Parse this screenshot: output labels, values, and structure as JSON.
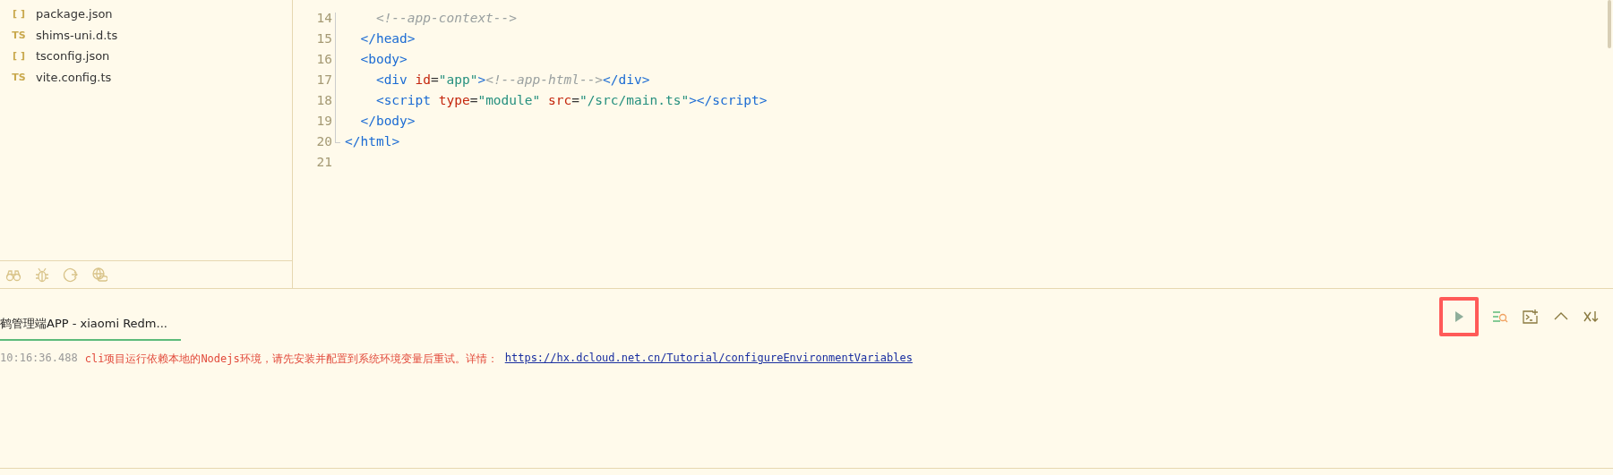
{
  "sidebar": {
    "files": [
      {
        "badge": "[ ]",
        "name": "package.json"
      },
      {
        "badge": "TS",
        "name": "shims-uni.d.ts"
      },
      {
        "badge": "[ ]",
        "name": "tsconfig.json"
      },
      {
        "badge": "TS",
        "name": "vite.config.ts"
      }
    ]
  },
  "editor": {
    "lines": [
      {
        "children": [
          {
            "children": [
              {
                "number": "14",
                "tokens": [
                  {
                    "kind": "comment",
                    "text": "<!--app-context-->"
                  }
                ]
              }
            ]
          },
          {
            "number": "15",
            "tokens": [
              {
                "kind": "tag",
                "text": "</head>"
              }
            ]
          },
          {
            "number": "16",
            "tokens": [
              {
                "kind": "tag",
                "text": "<body>"
              }
            ],
            "children": [
              {
                "number": "17",
                "tokens": [
                  {
                    "kind": "tag",
                    "text": "<div "
                  },
                  {
                    "kind": "attr",
                    "text": "id"
                  },
                  {
                    "kind": "text",
                    "text": "="
                  },
                  {
                    "kind": "string",
                    "text": "\"app\""
                  },
                  {
                    "kind": "tag",
                    "text": ">"
                  },
                  {
                    "kind": "comment",
                    "text": "<!--app-html-->"
                  },
                  {
                    "kind": "tag",
                    "text": "</div>"
                  }
                ]
              },
              {
                "number": "18",
                "tokens": [
                  {
                    "kind": "tag",
                    "text": "<script "
                  },
                  {
                    "kind": "attr",
                    "text": "type"
                  },
                  {
                    "kind": "text",
                    "text": "="
                  },
                  {
                    "kind": "string",
                    "text": "\"module\""
                  },
                  {
                    "kind": "attr",
                    "text": " src"
                  },
                  {
                    "kind": "text",
                    "text": "="
                  },
                  {
                    "kind": "string",
                    "text": "\"/src/main.ts\""
                  },
                  {
                    "kind": "tag",
                    "text": "></script>"
                  }
                ]
              }
            ]
          },
          {
            "number": "19",
            "tokens": [
              {
                "kind": "tag",
                "text": "</body>"
              }
            ]
          }
        ]
      },
      {
        "number": "20",
        "tokens": [
          {
            "kind": "tag",
            "text": "</html>"
          }
        ]
      },
      {
        "number": "21"
      }
    ]
  },
  "console": {
    "tab": {
      "label": "鹤管理端APP - xiaomi Redm...",
      "selected": true
    },
    "toolbar": [
      {
        "kind": "run",
        "highlighted": true
      },
      {
        "kind": "search-log",
        "highlighted": false
      },
      {
        "kind": "new-terminal",
        "highlighted": false
      },
      {
        "kind": "collapse",
        "highlighted": false
      },
      {
        "kind": "clear",
        "highlighted": false
      }
    ],
    "log": {
      "time": "10:16:36.488",
      "message": "cli项目运行依赖本地的Nodejs环境，请先安装并配置到系统环境变量后重试。详情：",
      "link": "https://hx.dcloud.net.cn/Tutorial/configureEnvironmentVariables"
    }
  }
}
